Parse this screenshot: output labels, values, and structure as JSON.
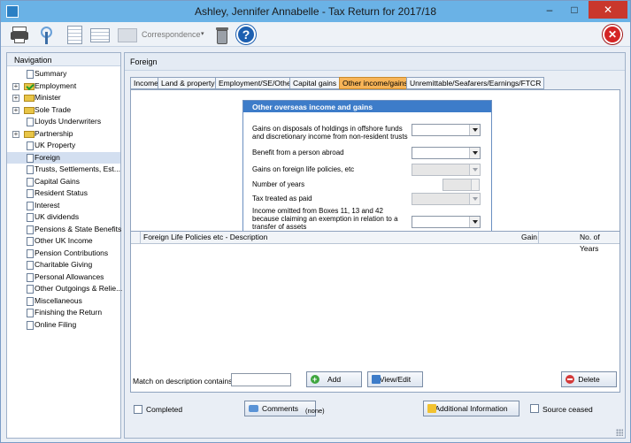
{
  "window": {
    "title": "Ashley, Jennifer Annabelle - Tax Return for 2017/18",
    "minimize_glyph": "–",
    "maximize_glyph": "□",
    "close_glyph": "✕"
  },
  "toolbar": {
    "correspondence_label": "Correspondence",
    "correspondence_arrow": "▾",
    "help_glyph": "?",
    "exit_glyph": "✕",
    "icons": [
      "printer-icon",
      "antenna-icon",
      "sheet-icon",
      "grid-icon",
      "correspondence-icon",
      "wastebin-icon",
      "help-icon",
      "exit-icon"
    ]
  },
  "navigation": {
    "header": "Navigation",
    "items": [
      {
        "label": "Summary",
        "icon": "document-icon",
        "expandable": false
      },
      {
        "label": "Employment",
        "icon": "checked-folder-icon",
        "expandable": true
      },
      {
        "label": "Minister",
        "icon": "folder-icon",
        "expandable": true
      },
      {
        "label": "Sole Trade",
        "icon": "folder-icon",
        "expandable": true
      },
      {
        "label": "Lloyds Underwriters",
        "icon": "document-icon",
        "expandable": false
      },
      {
        "label": "Partnership",
        "icon": "folder-icon",
        "expandable": true
      },
      {
        "label": "UK Property",
        "icon": "document-icon",
        "expandable": false
      },
      {
        "label": "Foreign",
        "icon": "document-icon",
        "expandable": false,
        "selected": true
      },
      {
        "label": "Trusts, Settlements, Est...",
        "icon": "document-icon",
        "expandable": false
      },
      {
        "label": "Capital Gains",
        "icon": "document-icon",
        "expandable": false
      },
      {
        "label": "Resident Status",
        "icon": "document-icon",
        "expandable": false
      },
      {
        "label": "Interest",
        "icon": "document-icon",
        "expandable": false
      },
      {
        "label": "UK dividends",
        "icon": "document-icon",
        "expandable": false
      },
      {
        "label": "Pensions & State Benefits",
        "icon": "document-icon",
        "expandable": false
      },
      {
        "label": "Other UK Income",
        "icon": "document-icon",
        "expandable": false
      },
      {
        "label": "Pension Contributions",
        "icon": "document-icon",
        "expandable": false
      },
      {
        "label": "Charitable Giving",
        "icon": "document-icon",
        "expandable": false
      },
      {
        "label": "Personal Allowances",
        "icon": "document-icon",
        "expandable": false
      },
      {
        "label": "Other Outgoings & Relie...",
        "icon": "document-icon",
        "expandable": false
      },
      {
        "label": "Miscellaneous",
        "icon": "document-icon",
        "expandable": false
      },
      {
        "label": "Finishing the Return",
        "icon": "document-icon",
        "expandable": false
      },
      {
        "label": "Online Filing",
        "icon": "document-icon",
        "expandable": false
      }
    ]
  },
  "main": {
    "header": "Foreign",
    "tabs": [
      {
        "label": "Income"
      },
      {
        "label": "Land & property"
      },
      {
        "label": "Employment/SE/Other"
      },
      {
        "label": "Capital gains"
      },
      {
        "label": "Other income/gains",
        "active": true
      },
      {
        "label": "Unremittable/Seafarers/Earnings/FTCR"
      }
    ],
    "group": {
      "title": "Other overseas income and gains",
      "fields": {
        "offshore_gains_label": "Gains on disposals of holdings in offshore funds and discretionary income from non-resident trusts",
        "offshore_gains_value": "",
        "benefit_label": "Benefit from a person abroad",
        "benefit_value": "",
        "life_policies_label": "Gains on foreign life policies, etc",
        "life_policies_value": "",
        "years_label": "Number of years",
        "years_value": "",
        "tax_paid_label": "Tax treated as paid",
        "tax_paid_value": "",
        "omitted_label": "Income omitted from Boxes 11, 13 and 42 because claiming an exemption in relation to a transfer of assets",
        "omitted_value": ""
      }
    },
    "table": {
      "columns": [
        "Foreign Life Policies etc - Description",
        "Gain",
        "No. of Years"
      ],
      "rows": []
    },
    "filter": {
      "label": "Match on description contains",
      "value": ""
    },
    "buttons": {
      "add": "Add",
      "view_edit": "View/Edit",
      "delete": "Delete",
      "comments": "Comments",
      "additional_info": "Additional Information"
    },
    "footer": {
      "completed_label": "Completed",
      "comments_status": "(none)",
      "source_ceased_label": "Source ceased"
    }
  },
  "colors": {
    "titlebar": "#6ab2e6",
    "active_tab": "#f7b457",
    "group_header": "#3d7cc9",
    "close_button": "#c9372c"
  }
}
